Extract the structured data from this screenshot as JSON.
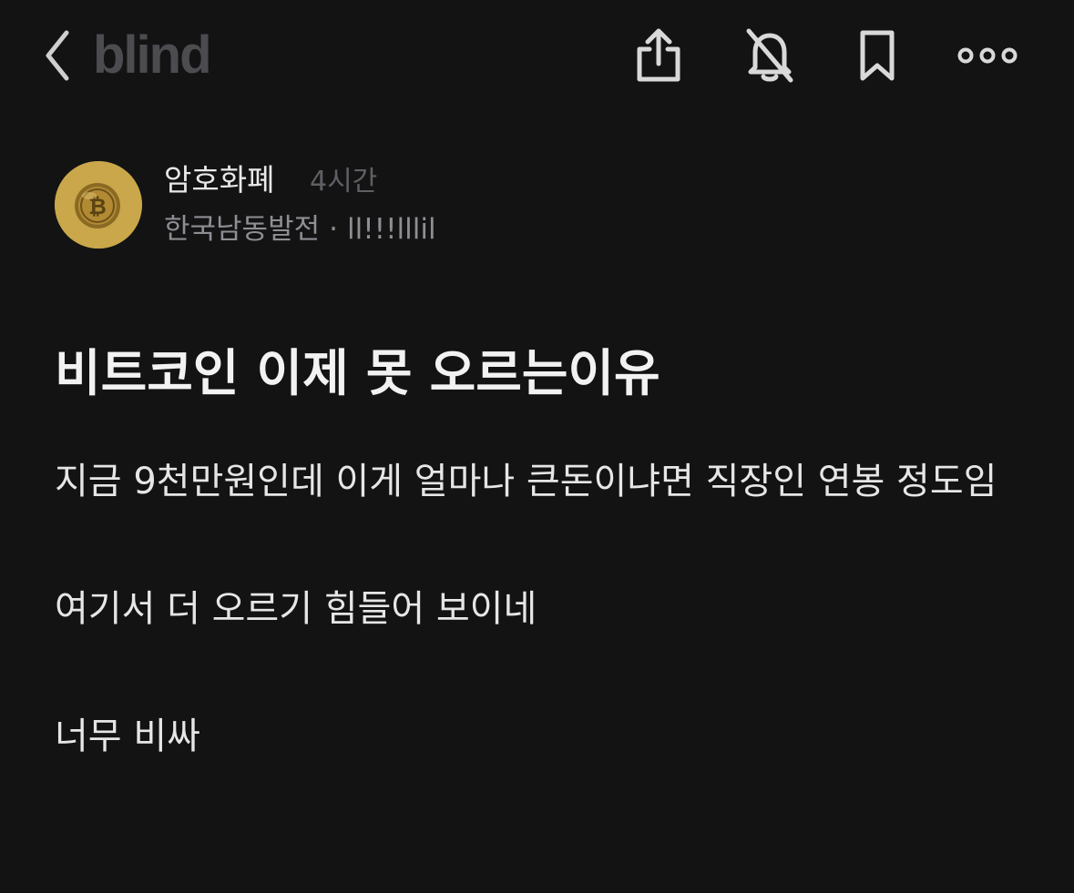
{
  "header": {
    "logo": "blind",
    "icons": [
      "back-icon",
      "share-icon",
      "bell-off-icon",
      "bookmark-icon",
      "more-icon"
    ]
  },
  "author": {
    "name": "암호화폐",
    "time": "4시간",
    "company": "한국남동발전",
    "separator": "·",
    "nickname": "ll!!!lllil",
    "avatar_color": "#c9a74a"
  },
  "post": {
    "title": "비트코인 이제 못 오르는이유",
    "paragraphs": [
      "지금 9천만원인데 이게 얼마나 큰돈이냐면 직장인 연봉 정도임",
      "여기서 더 오르기 힘들어 보이네",
      "너무 비싸"
    ]
  },
  "colors": {
    "background": "#131314",
    "text": "#e6e6e6",
    "muted": "#8e8e93",
    "logo": "#4b4b50"
  }
}
